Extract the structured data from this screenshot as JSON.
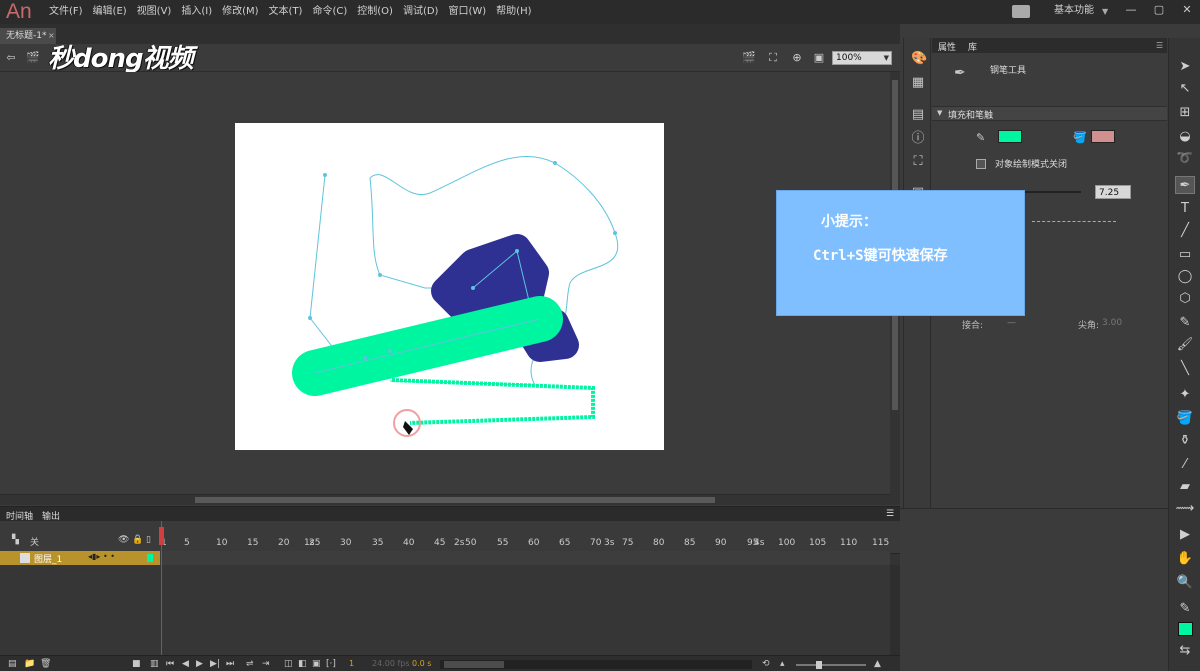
{
  "app": {
    "logo": "An",
    "menus": [
      "文件(F)",
      "编辑(E)",
      "视图(V)",
      "插入(I)",
      "修改(M)",
      "文本(T)",
      "命令(C)",
      "控制(O)",
      "调试(D)",
      "窗口(W)",
      "帮助(H)"
    ],
    "workspace": "基本功能",
    "window_controls": [
      "—",
      "▢",
      "✕"
    ]
  },
  "document": {
    "tab_title": "无标题-1*",
    "tab_close": "×",
    "zoom": "100%"
  },
  "watermark": "秒dong视频",
  "tip": {
    "title": "小提示：",
    "text": "Ctrl+S键可快速保存"
  },
  "properties": {
    "tabs": [
      "属性",
      "库"
    ],
    "tool_name": "钢笔工具",
    "section_fill_stroke": "填充和笔触",
    "object_draw_mode": "对象绘制模式关闭",
    "stroke_width": "7.25",
    "join_label": "接合:",
    "join_value": "—",
    "miter_label": "尖角:",
    "miter_value": "3.00",
    "stroke_color": "#00f5a0",
    "fill_color": "#d09090"
  },
  "stage_colors": {
    "shape_dark": "#2e3192",
    "shape_green": "#00f5a0",
    "outline": "#5ec4dc"
  },
  "timeline": {
    "tabs": [
      "时间轴",
      "输出"
    ],
    "layer_head_label": "关",
    "layer_name": "图层_1",
    "ruler": [
      "1",
      "5",
      "10",
      "15",
      "20",
      "25",
      "30",
      "35",
      "40",
      "45",
      "50",
      "55",
      "60",
      "65",
      "70",
      "75",
      "80",
      "85",
      "90",
      "95",
      "100",
      "105",
      "110",
      "115"
    ],
    "seconds": [
      "1s",
      "2s",
      "3s",
      "4s"
    ],
    "current_frame": "1",
    "fps": "24.00 fps",
    "time": "0.0 s"
  }
}
